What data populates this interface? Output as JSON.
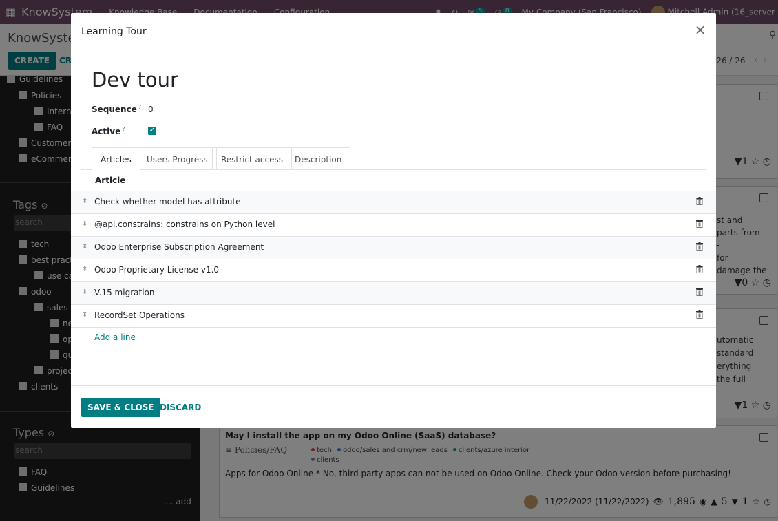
{
  "topbar": {
    "app_name": "KnowSystem",
    "menus": [
      "Knowledge Base",
      "Documentation",
      "Configuration"
    ],
    "messages_count": "5",
    "activities_count": "8",
    "company": "My Company (San Francisco)",
    "user": "Mitchell Admin (16_server"
  },
  "control_panel": {
    "breadcrumb": "KnowSystem",
    "create_label": "CREATE",
    "create2_label": "CR",
    "pager": "-26 / 26"
  },
  "sidebar": {
    "sections_top": [
      "Guidelines",
      "Policies",
      "Intern",
      "FAQ",
      "Customer",
      "eCommer"
    ],
    "tags_title": "Tags",
    "tags_search": "search",
    "tags": [
      "tech",
      "best pract",
      "use ca",
      "odoo",
      "sales a",
      "ne",
      "op",
      "qu",
      "projec",
      "clients"
    ],
    "types_title": "Types",
    "types_search": "search",
    "types": [
      "FAQ",
      "Guidelines"
    ],
    "add_label": "... add"
  },
  "cards": {
    "snippets": [
      "st and",
      "parts from",
      "-",
      "for",
      "damage the",
      "utomatic",
      "standard",
      "erything",
      "the full"
    ],
    "last": {
      "title": "May I install the app on my Odoo Online (SaaS) database?",
      "category": "Policies/FAQ",
      "tags": [
        "tech",
        "odoo/sales and crm/new leads",
        "clients/azure interior",
        "clients"
      ],
      "description": "Apps for Odoo Online * No, third party apps can not be used on Odoo Online. Check your Odoo version before purchasing!",
      "date": "11/22/2022 (11/22/2022)",
      "views": "1,895",
      "likes": "5",
      "dislikes": "1"
    },
    "counts": [
      "1",
      "0",
      "1"
    ]
  },
  "modal": {
    "title": "Learning Tour",
    "record_name": "Dev tour",
    "sequence_label": "Sequence",
    "sequence_value": "0",
    "active_label": "Active",
    "help_mark": "?",
    "tabs": [
      "Articles",
      "Users Progress",
      "Restrict access",
      "Description"
    ],
    "column_header": "Article",
    "articles": [
      "Check whether model has attribute",
      "@api.constrains: constrains on Python level",
      "Odoo Enterprise Subscription Agreement",
      "Odoo Proprietary License v1.0",
      "V.15 migration",
      "RecordSet Operations"
    ],
    "add_line": "Add a line",
    "save_label": "SAVE & CLOSE",
    "discard_label": "DISCARD"
  },
  "colors": {
    "brand": "#714b67",
    "accent": "#017e84"
  }
}
